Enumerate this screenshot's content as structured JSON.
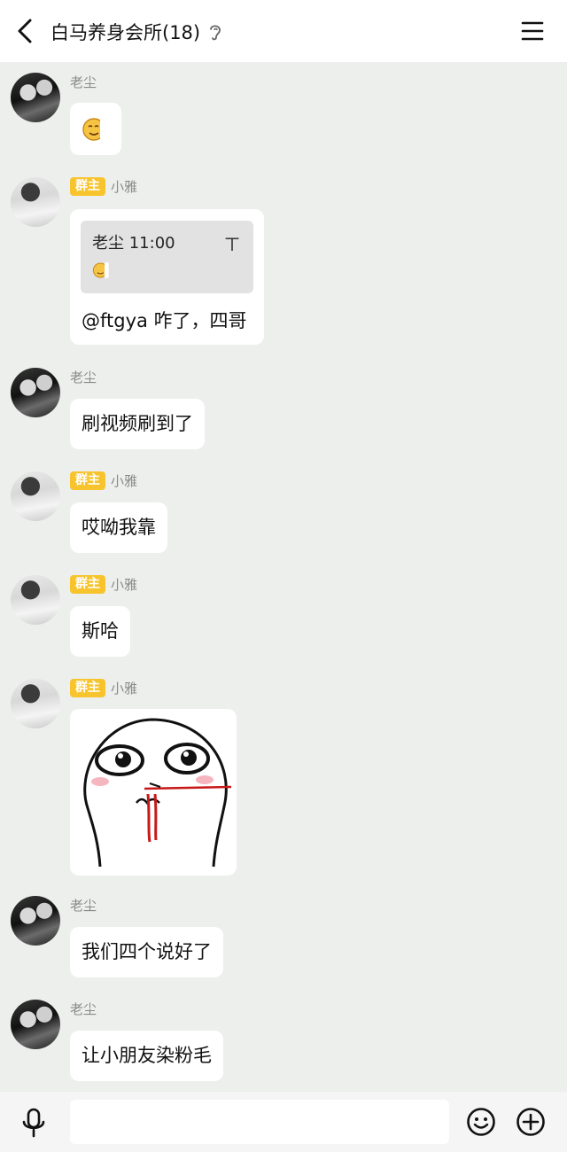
{
  "header": {
    "title": "白马养身会所(18)",
    "back_icon": "chevron-left-icon",
    "ear_icon": "ear-icon",
    "menu_icon": "hamburger-menu-icon"
  },
  "messages": [
    {
      "sender": "老尘",
      "badge": "",
      "type": "emoji",
      "avatar": "avatar-dark"
    },
    {
      "sender": "小雅",
      "badge": "群主",
      "type": "quote",
      "quote": {
        "header": "老尘 11:00",
        "pin": "ㄒ",
        "icon": "emoji-icon"
      },
      "text": "@ftgya 咋了，四哥",
      "avatar": "avatar-light"
    },
    {
      "sender": "老尘",
      "badge": "",
      "type": "text",
      "text": "刷视频刷到了",
      "avatar": "avatar-dark"
    },
    {
      "sender": "小雅",
      "badge": "群主",
      "type": "text",
      "text": "哎呦我靠",
      "avatar": "avatar-light"
    },
    {
      "sender": "小雅",
      "badge": "群主",
      "type": "text",
      "text": "斯哈",
      "avatar": "avatar-light"
    },
    {
      "sender": "小雅",
      "badge": "群主",
      "type": "sticker",
      "sticker": "nosebleed-sticker",
      "avatar": "avatar-light"
    },
    {
      "sender": "老尘",
      "badge": "",
      "type": "text",
      "text": "我们四个说好了",
      "avatar": "avatar-dark"
    },
    {
      "sender": "老尘",
      "badge": "",
      "type": "text",
      "text": "让小朋友染粉毛",
      "avatar": "avatar-dark"
    }
  ],
  "footer": {
    "input_placeholder": "",
    "mic_icon": "microphone-icon",
    "emoji_icon": "smiley-icon",
    "plus_icon": "plus-circle-icon"
  },
  "colors": {
    "background": "#ECEFEC",
    "bubble": "#FFFFFF",
    "badge": "#F8C42E",
    "header": "#FFFFFF"
  }
}
